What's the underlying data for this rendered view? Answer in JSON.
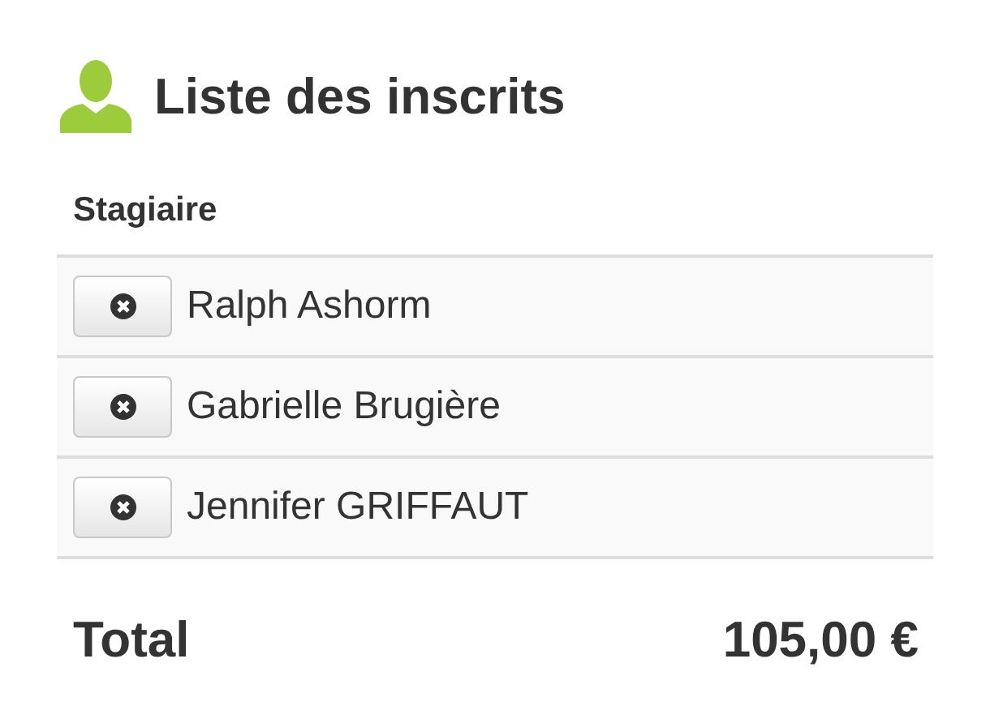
{
  "title": "Liste des inscrits",
  "table": {
    "columns": [
      "Stagiaire"
    ],
    "rows": [
      {
        "name": "Ralph Ashorm"
      },
      {
        "name": "Gabrielle Brugière"
      },
      {
        "name": "Jennifer GRIFFAUT"
      }
    ]
  },
  "total": {
    "label": "Total",
    "amount": "105,00 €"
  }
}
